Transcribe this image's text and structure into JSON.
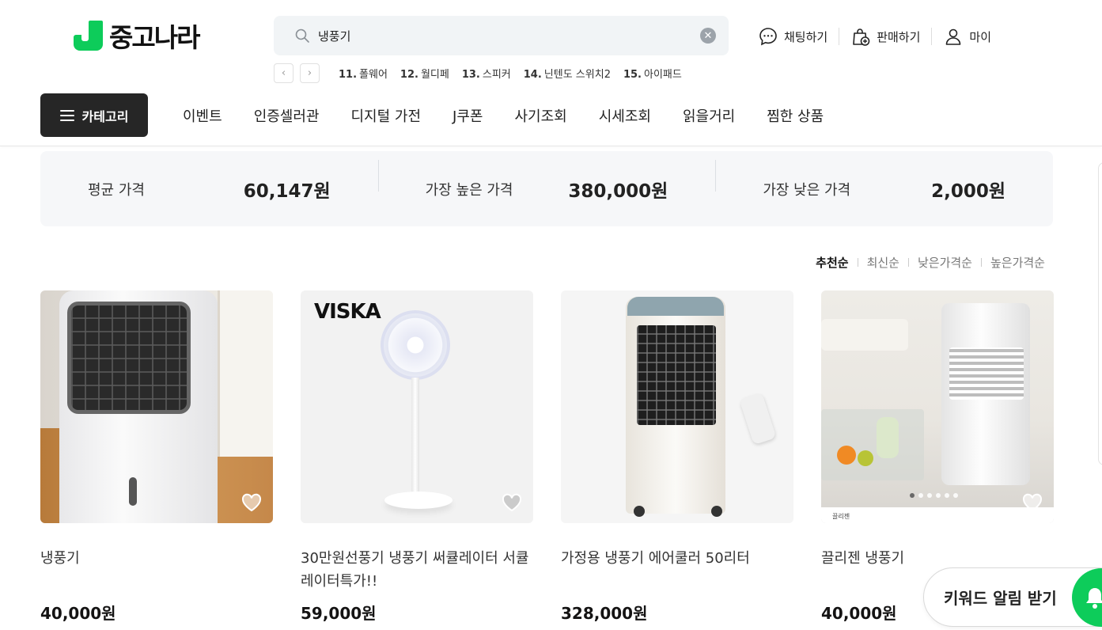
{
  "header": {
    "logo_text": "중고나라",
    "search": {
      "value": "냉풍기",
      "placeholder": ""
    },
    "actions": [
      {
        "label": "채팅하기",
        "icon": "chat-icon"
      },
      {
        "label": "판매하기",
        "icon": "sell-bag-icon"
      },
      {
        "label": "마이",
        "icon": "user-icon"
      }
    ],
    "popular_keywords": [
      {
        "rank": "11.",
        "text": "폴웨어"
      },
      {
        "rank": "12.",
        "text": "월디페"
      },
      {
        "rank": "13.",
        "text": "스피커"
      },
      {
        "rank": "14.",
        "text": "닌텐도 스위치2"
      },
      {
        "rank": "15.",
        "text": "아이패드"
      }
    ]
  },
  "nav": {
    "category_label": "카테고리",
    "items": [
      "이벤트",
      "인증셀러관",
      "디지털 가전",
      "J쿠폰",
      "사기조회",
      "시세조회",
      "읽을거리",
      "찜한 상품"
    ]
  },
  "price_summary": {
    "average": {
      "label": "평균 가격",
      "value": "60,147원"
    },
    "highest": {
      "label": "가장 높은 가격",
      "value": "380,000원"
    },
    "lowest": {
      "label": "가장 낮은 가격",
      "value": "2,000원"
    }
  },
  "sort": {
    "options": [
      "추천순",
      "최신순",
      "낮은가격순",
      "높은가격순"
    ],
    "active": "추천순"
  },
  "products": [
    {
      "title": "냉풍기",
      "price": "40,000원"
    },
    {
      "title": "30만원선풍기 냉풍기 써큘레이터 서큘레이터특가!!",
      "price": "59,000원",
      "image_text": "VISKA"
    },
    {
      "title": "가정용 냉풍기 에어쿨러 50리터",
      "price": "328,000원"
    },
    {
      "title": "끌리젠 냉풍기",
      "price": "40,000원",
      "image_text": "끌리젠"
    }
  ],
  "keyword_alert": {
    "label": "키워드 알림 받기"
  },
  "colors": {
    "brand": "#0dcc5a",
    "category_button": "#262626"
  }
}
